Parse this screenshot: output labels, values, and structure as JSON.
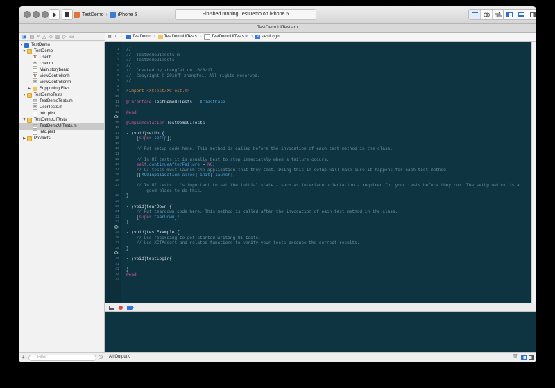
{
  "toolbar": {
    "scheme_app": "TestDemo",
    "scheme_device": "iPhone 5",
    "status_text": "Finished running TestDemo on iPhone 5"
  },
  "window_title": "TestDemoUITests.m",
  "navigator": {
    "rows": [
      {
        "label": "TestDemo",
        "icon": "project-icon"
      },
      {
        "label": "TestDemo",
        "icon": "folder-icon"
      },
      {
        "label": "User.h",
        "icon": "header-file-icon"
      },
      {
        "label": "User.m",
        "icon": "implementation-file-icon"
      },
      {
        "label": "Main.storyboard",
        "icon": "storyboard-icon"
      },
      {
        "label": "ViewController.h",
        "icon": "header-file-icon"
      },
      {
        "label": "ViewController.m",
        "icon": "implementation-file-icon"
      },
      {
        "label": "Supporting Files",
        "icon": "folder-icon"
      },
      {
        "label": "TestDemoTests",
        "icon": "folder-icon"
      },
      {
        "label": "TestDemoTests.m",
        "icon": "implementation-file-icon"
      },
      {
        "label": "UserTests.m",
        "icon": "implementation-file-icon"
      },
      {
        "label": "Info.plist",
        "icon": "plist-icon"
      },
      {
        "label": "TestDemoUITests",
        "icon": "folder-icon"
      },
      {
        "label": "TestDemoUITests.m",
        "icon": "implementation-file-icon"
      },
      {
        "label": "Info.plist",
        "icon": "plist-icon"
      },
      {
        "label": "Products",
        "icon": "folder-icon"
      }
    ],
    "filter_placeholder": "Filter"
  },
  "jumpbar": {
    "crumbs": [
      "TestDemo",
      "TestDemoUITests",
      "TestDemoUITests.m",
      "-testLogin"
    ]
  },
  "editor": {
    "line_numbers": [
      "1",
      "2",
      "3",
      "4",
      "5",
      "6",
      "7",
      "8",
      "9",
      "10",
      "11",
      "12",
      "13",
      "14",
      "15",
      "16",
      "17",
      "18",
      "19",
      "20",
      "21",
      "22",
      "23",
      "24",
      "25",
      "26",
      "27",
      "28",
      "29",
      "30",
      "31",
      "32",
      "33",
      "34",
      "35",
      "36",
      "37",
      "38",
      "39",
      "40",
      "41",
      "42",
      "43",
      "44"
    ],
    "lines": {
      "l1": "//",
      "l2": "//  TestDemoUITests.m",
      "l3": "//  TestDemoUITests",
      "l4": "//",
      "l5": "//  Created by zhangfei on 16/3/17.",
      "l6": "//  Copyright © 2016年 zhangfei. All rights reserved.",
      "l7": "//",
      "l9a": "#import ",
      "l9b": "<XCTest/XCTest.h>",
      "l11a": "@interface",
      "l11b": " TestDemoUITests : ",
      "l11c": "XCTestCase",
      "l13": "@end",
      "l15a": "@implementation",
      "l15b": " TestDemoUITests",
      "l17": "- (void)setUp {",
      "l18a": "    [",
      "l18b": "super",
      "l18c": " ",
      "l18d": "setUp",
      "l18e": "];",
      "l20": "    // Put setup code here. This method is called before the invocation of each test method in the class.",
      "l22": "    // In UI tests it is usually best to stop immediately when a failure occurs.",
      "l23a": "    ",
      "l23b": "self",
      "l23c": ".",
      "l23d": "continueAfterFailure",
      "l23e": " = ",
      "l23f": "NO",
      "l23g": ";",
      "l24": "    // UI tests must launch the application that they test. Doing this in setup will make sure it happens for each test method.",
      "l25a": "    [[",
      "l25b": "XCUIApplication",
      "l25c": " ",
      "l25d": "alloc",
      "l25e": "] ",
      "l25f": "init",
      "l25g": "] ",
      "l25h": "launch",
      "l25i": "];",
      "l27": "    // In UI tests it’s important to set the initial state - such as interface orientation - required for your tests before they run. The setUp method is a",
      "l27b": "        good place to do this.",
      "l28": "}",
      "l30": "- (void)tearDown {",
      "l31": "    // Put teardown code here. This method is called after the invocation of each test method in the class.",
      "l32a": "    [",
      "l32b": "super",
      "l32c": " ",
      "l32d": "tearDown",
      "l32e": "];",
      "l33": "}",
      "l35": "- (void)testExample {",
      "l36": "    // Use recording to get started writing UI tests.",
      "l37": "    // Use XCTAssert and related functions to verify your tests produce the correct results.",
      "l38": "}",
      "l40": "- (void)testLogin{",
      "l42": "}",
      "l43": "@end"
    }
  },
  "output": {
    "selector_label": "All Output ◊"
  },
  "colors": {
    "editor_bg": "#0f3441",
    "keyword": "#c55a9b",
    "comment": "#6e8d99",
    "preprocessor": "#c98a3c",
    "class": "#5fa8dd"
  }
}
